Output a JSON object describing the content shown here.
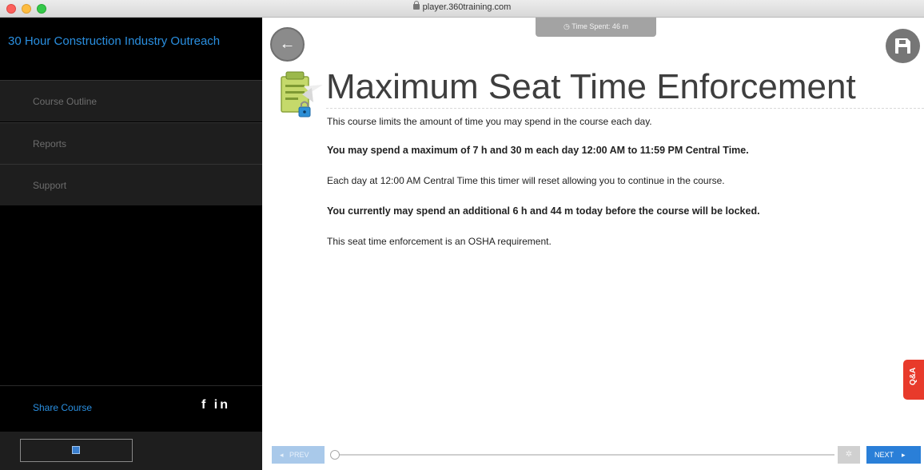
{
  "browser": {
    "url": "player.360training.com"
  },
  "sidebar": {
    "course_title": "30 Hour Construction Industry Outreach",
    "items": [
      {
        "label": "Course Outline"
      },
      {
        "label": "Reports"
      },
      {
        "label": "Support"
      }
    ],
    "share_label": "Share Course",
    "social": "f in"
  },
  "header": {
    "time_spent": "Time Spent: 46 m"
  },
  "main": {
    "title": "Maximum Seat Time Enforcement",
    "paragraphs": [
      "This course limits the amount of time you may spend in the course each day.",
      "You may spend a maximum of 7 h and 30 m each day 12:00 AM to 11:59 PM Central Time.",
      "Each day at 12:00 AM Central Time this timer will reset allowing you to continue in the course.",
      "You currently may spend an additional 6 h and 44 m today before the course will be locked.",
      "This seat time enforcement is an OSHA requirement."
    ],
    "qa_label": "Q&A"
  },
  "footer": {
    "prev_label": "PREV",
    "next_label": "NEXT",
    "progress": 0
  },
  "colors": {
    "accent": "#2a7fd8",
    "qa": "#e83a2b"
  }
}
